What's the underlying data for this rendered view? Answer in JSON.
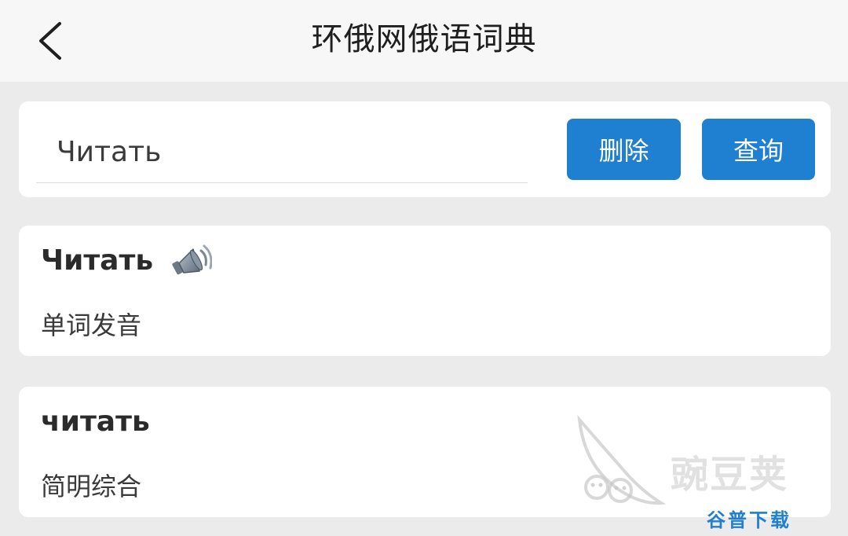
{
  "header": {
    "title": "环俄网俄语词典",
    "back_icon": "chevron-left-icon"
  },
  "search": {
    "value": "Читать",
    "delete_label": "删除",
    "query_label": "查询"
  },
  "results": [
    {
      "word": "Читать",
      "icon": "speaker-icon",
      "source": "单词发音"
    },
    {
      "word": "читать",
      "source": "简明综合"
    }
  ],
  "watermark": {
    "brand": "豌豆荚",
    "sub": "谷普下载"
  },
  "colors": {
    "accent": "#1f7fd0",
    "background": "#ebebeb",
    "header": "#f7f7f7",
    "card": "#ffffff"
  }
}
